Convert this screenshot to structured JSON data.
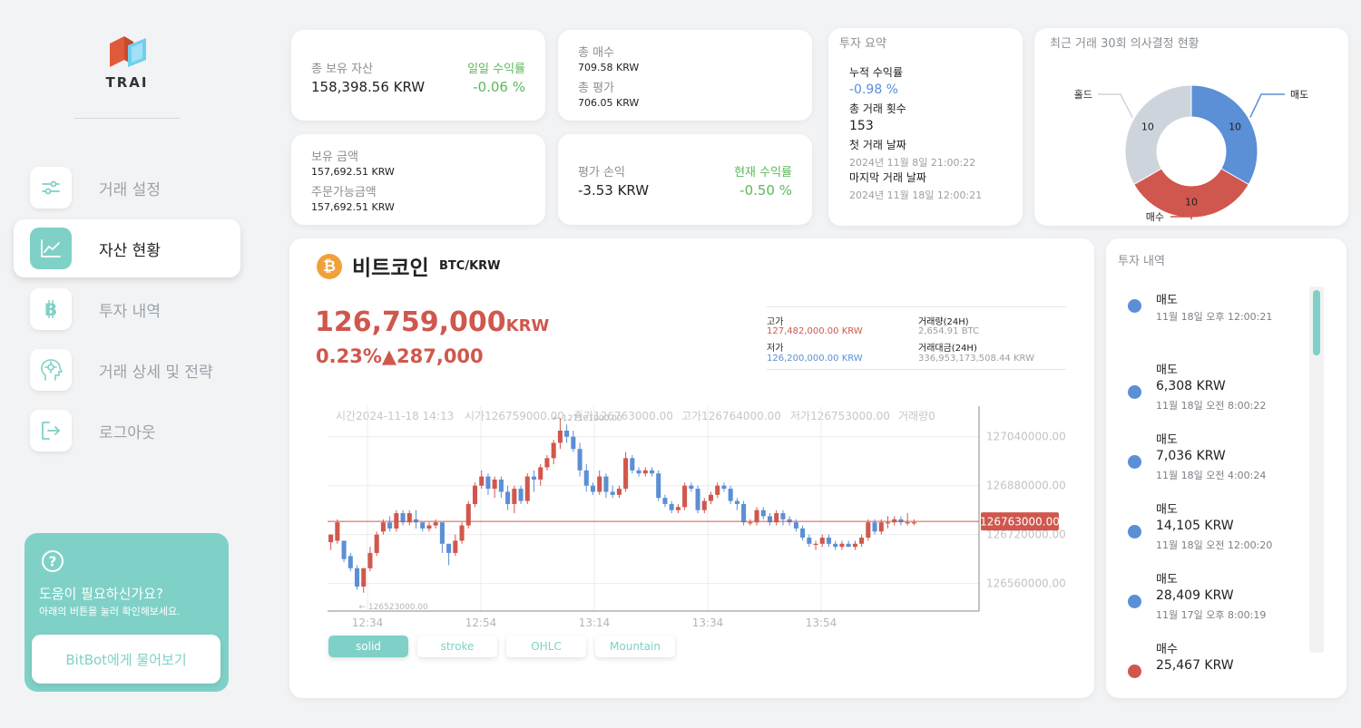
{
  "app": {
    "logo_text": "TRAI"
  },
  "colors": {
    "accent": "#7fd1c7",
    "sell": "#5b8fd6",
    "buy": "#d0574d",
    "hold": "#ced4dc"
  },
  "sidebar": {
    "items": [
      {
        "label": "거래 설정",
        "icon": "sliders-icon",
        "active": false
      },
      {
        "label": "자산 현황",
        "icon": "chart-line-icon",
        "active": true
      },
      {
        "label": "투자 내역",
        "icon": "bitcoin-icon",
        "active": false
      },
      {
        "label": "거래 상세 및 전략",
        "icon": "brain-head-icon",
        "active": false
      },
      {
        "label": "로그아웃",
        "icon": "logout-icon",
        "active": false
      }
    ],
    "help": {
      "title": "도움이 필요하신가요?",
      "subtitle": "아래의 버튼을 눌러 확인해보세요.",
      "button": "BitBot에게 물어보기"
    }
  },
  "summary": {
    "total_assets_label": "총 보유 자산",
    "total_assets_value": "158,398.56 KRW",
    "daily_return_label": "일일 수익률",
    "daily_return_value": "-0.06 %",
    "total_buy_label": "총 매수",
    "total_buy_value": "709.58 KRW",
    "total_eval_label": "총 평가",
    "total_eval_value": "706.05 KRW",
    "holding_label": "보유 금액",
    "holding_value": "157,692.51 KRW",
    "orderable_label": "주문가능금액",
    "orderable_value": "157,692.51 KRW",
    "eval_pl_label": "평가 손익",
    "eval_pl_value": "-3.53 KRW",
    "current_return_label": "현재 수익률",
    "current_return_value": "-0.50 %"
  },
  "invest_summary": {
    "title": "투자 요약",
    "cum_return_label": "누적 수익률",
    "cum_return_value": "-0.98 %",
    "trade_count_label": "총 거래 횟수",
    "trade_count_value": "153",
    "first_trade_label": "첫 거래 날짜",
    "first_trade_value": "2024년 11월 8일 21:00:22",
    "last_trade_label": "마지막 거래 날짜",
    "last_trade_value": "2024년 11월 18일 12:00:21"
  },
  "decisions": {
    "title": "최근 거래 30회 의사결정 현황",
    "chart_data": {
      "type": "pie",
      "donut": true,
      "slices": [
        {
          "name": "매도",
          "value": 10,
          "color": "#5b8fd6"
        },
        {
          "name": "매수",
          "value": 10,
          "color": "#d0574d"
        },
        {
          "name": "홀드",
          "value": 10,
          "color": "#ced4dc"
        }
      ]
    }
  },
  "coin": {
    "icon": "bitcoin-coin-icon",
    "name": "비트코인",
    "pair": "BTC/KRW",
    "price": "126,759,000",
    "price_unit": "KRW",
    "change": "0.23%▲287,000",
    "high_label": "고가",
    "high_value": "127,482,000.00 KRW",
    "low_label": "저가",
    "low_value": "126,200,000.00 KRW",
    "volume_label": "거래량(24H)",
    "volume_value": "2,654.91 BTC",
    "amount_label": "거래대금(24H)",
    "amount_value": "336,953,173,508.44 KRW"
  },
  "candle": {
    "legend": {
      "time": "시간2024-11-18 14:13",
      "open": "시가126759000.00",
      "close": "종가126763000.00",
      "high": "고가126764000.00",
      "low": "저가126753000.00",
      "volume": "거래량0"
    },
    "max_marker": "← 127101000.00",
    "min_marker": "← 126523000.00",
    "current_tag": "126763000.00",
    "y_ticks": [
      "127040000.00",
      "126880000.00",
      "126720000.00",
      "126560000.00"
    ],
    "x_ticks": [
      "12:34",
      "12:54",
      "13:14",
      "13:34",
      "13:54"
    ],
    "tabs": [
      "solid",
      "stroke",
      "OHLC",
      "Mountain"
    ],
    "chart_data": {
      "type": "candlestick",
      "y_range": [
        126470000,
        127140000
      ],
      "current_price": 126763000,
      "high_point": 127101000,
      "low_point": 126523000,
      "candles": [
        [
          126695,
          126720,
          126720,
          126670
        ],
        [
          126700,
          126760,
          126770,
          126690
        ],
        [
          126700,
          126640,
          126700,
          126630
        ],
        [
          126650,
          126610,
          126660,
          126600
        ],
        [
          126610,
          126550,
          126620,
          126540
        ],
        [
          126550,
          126610,
          126610,
          126530
        ],
        [
          126610,
          126660,
          126680,
          126600
        ],
        [
          126660,
          126720,
          126730,
          126650
        ],
        [
          126730,
          126760,
          126770,
          126720
        ],
        [
          126760,
          126740,
          126780,
          126730
        ],
        [
          126740,
          126790,
          126800,
          126730
        ],
        [
          126790,
          126760,
          126800,
          126750
        ],
        [
          126760,
          126790,
          126800,
          126750
        ],
        [
          126770,
          126760,
          126800,
          126740
        ],
        [
          126760,
          126740,
          126760,
          126730
        ],
        [
          126740,
          126750,
          126760,
          126730
        ],
        [
          126750,
          126760,
          126770,
          126740
        ],
        [
          126760,
          126690,
          126760,
          126660
        ],
        [
          126690,
          126660,
          126690,
          126620
        ],
        [
          126660,
          126700,
          126720,
          126650
        ],
        [
          126700,
          126750,
          126760,
          126690
        ],
        [
          126750,
          126820,
          126830,
          126740
        ],
        [
          126820,
          126880,
          126890,
          126810
        ],
        [
          126880,
          126910,
          126930,
          126870
        ],
        [
          126910,
          126870,
          126920,
          126850
        ],
        [
          126870,
          126900,
          126910,
          126840
        ],
        [
          126900,
          126860,
          126910,
          126840
        ],
        [
          126860,
          126820,
          126880,
          126800
        ],
        [
          126820,
          126870,
          126880,
          126790
        ],
        [
          126870,
          126830,
          126880,
          126820
        ],
        [
          126830,
          126910,
          126920,
          126820
        ],
        [
          126910,
          126900,
          126930,
          126860
        ],
        [
          126900,
          126940,
          126950,
          126880
        ],
        [
          126940,
          126970,
          126980,
          126930
        ],
        [
          126970,
          127020,
          127030,
          126950
        ],
        [
          127020,
          127060,
          127101,
          127000
        ],
        [
          127060,
          127040,
          127080,
          127020
        ],
        [
          127040,
          127000,
          127060,
          126990
        ],
        [
          127000,
          126930,
          127020,
          126910
        ],
        [
          126930,
          126880,
          126950,
          126860
        ],
        [
          126880,
          126860,
          126890,
          126850
        ],
        [
          126860,
          126910,
          126930,
          126850
        ],
        [
          126910,
          126860,
          126920,
          126840
        ],
        [
          126860,
          126850,
          126880,
          126840
        ],
        [
          126850,
          126870,
          126880,
          126840
        ],
        [
          126870,
          126970,
          126990,
          126860
        ],
        [
          126970,
          126930,
          126980,
          126920
        ],
        [
          126930,
          126920,
          126940,
          126910
        ],
        [
          126920,
          126930,
          126940,
          126910
        ],
        [
          126930,
          126920,
          126940,
          126910
        ],
        [
          126920,
          126840,
          126930,
          126830
        ],
        [
          126840,
          126820,
          126850,
          126810
        ],
        [
          126820,
          126800,
          126830,
          126790
        ],
        [
          126800,
          126810,
          126820,
          126790
        ],
        [
          126810,
          126880,
          126890,
          126800
        ],
        [
          126880,
          126870,
          126890,
          126860
        ],
        [
          126870,
          126800,
          126880,
          126790
        ],
        [
          126800,
          126830,
          126840,
          126790
        ],
        [
          126830,
          126850,
          126860,
          126820
        ],
        [
          126850,
          126880,
          126890,
          126840
        ],
        [
          126880,
          126870,
          126890,
          126860
        ],
        [
          126870,
          126830,
          126880,
          126820
        ],
        [
          126830,
          126820,
          126840,
          126800
        ],
        [
          126820,
          126760,
          126830,
          126750
        ],
        [
          126760,
          126760,
          126770,
          126750
        ],
        [
          126760,
          126800,
          126810,
          126750
        ],
        [
          126800,
          126780,
          126810,
          126770
        ],
        [
          126780,
          126760,
          126790,
          126750
        ],
        [
          126760,
          126790,
          126800,
          126750
        ],
        [
          126790,
          126770,
          126800,
          126750
        ],
        [
          126770,
          126760,
          126780,
          126750
        ],
        [
          126760,
          126740,
          126770,
          126730
        ],
        [
          126740,
          126710,
          126750,
          126700
        ],
        [
          126710,
          126690,
          126720,
          126680
        ],
        [
          126690,
          126690,
          126700,
          126670
        ],
        [
          126690,
          126710,
          126720,
          126680
        ],
        [
          126710,
          126690,
          126720,
          126680
        ],
        [
          126690,
          126680,
          126700,
          126670
        ],
        [
          126680,
          126690,
          126700,
          126670
        ],
        [
          126690,
          126680,
          126700,
          126680
        ],
        [
          126680,
          126690,
          126700,
          126670
        ],
        [
          126690,
          126710,
          126720,
          126680
        ],
        [
          126710,
          126760,
          126770,
          126700
        ],
        [
          126760,
          126730,
          126770,
          126720
        ],
        [
          126730,
          126760,
          126770,
          126720
        ],
        [
          126760,
          126760,
          126780,
          126740
        ],
        [
          126760,
          126770,
          126780,
          126750
        ],
        [
          126770,
          126760,
          126780,
          126750
        ],
        [
          126760,
          126760,
          126790,
          126750
        ],
        [
          126760,
          126760,
          126770,
          126750
        ]
      ]
    }
  },
  "history": {
    "title": "투자 내역",
    "items": [
      {
        "type": "매도",
        "amount": "",
        "time": "11월 18일 오후 12:00:21",
        "color": "#5b8fd6"
      },
      {
        "type": "매도",
        "amount": "6,308 KRW",
        "time": "11월 18일 오전 8:00:22",
        "color": "#5b8fd6"
      },
      {
        "type": "매도",
        "amount": "7,036 KRW",
        "time": "11월 18일 오전 4:00:24",
        "color": "#5b8fd6"
      },
      {
        "type": "매도",
        "amount": "14,105 KRW",
        "time": "11월 18일 오전 12:00:20",
        "color": "#5b8fd6"
      },
      {
        "type": "매도",
        "amount": "28,409 KRW",
        "time": "11월 17일 오후 8:00:19",
        "color": "#5b8fd6"
      },
      {
        "type": "매수",
        "amount": "25,467 KRW",
        "time": "",
        "color": "#d0574d"
      }
    ]
  }
}
